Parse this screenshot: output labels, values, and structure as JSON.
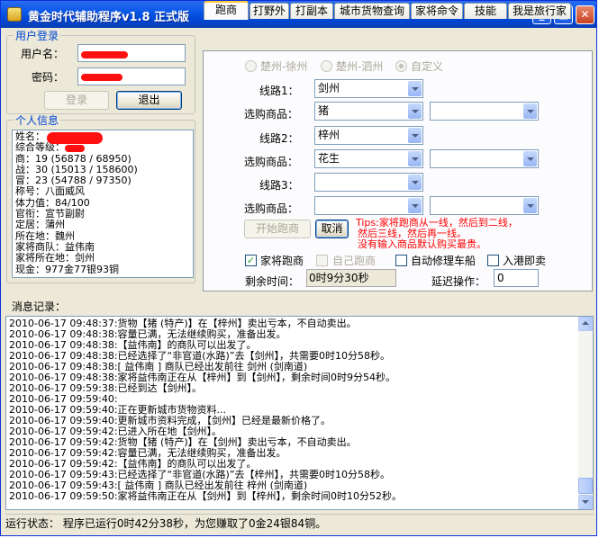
{
  "window": {
    "title": "黄金时代辅助程序v1.8 正式版",
    "min_icon": "minimize-icon",
    "max_icon": "maximize-icon",
    "close_icon": "close-icon"
  },
  "login": {
    "group_title": "用户登录",
    "user_label": "用户名：",
    "password_label": "密码：",
    "login_button": "登录",
    "logout_button": "退出"
  },
  "personal": {
    "group_title": "个人信息",
    "lines": [
      "姓名：",
      "综合等级：",
      "商：19 (56878 / 68950)",
      "战：30 (15013 / 158600)",
      "冒：23 (54788 / 97350)",
      "称号：八面威风",
      "体力值：84/100",
      "官衔：宣节副尉",
      "定居：蒲州",
      "所在地：魏州",
      "家将商队：益伟南",
      "家将所在地：剑州",
      "现金：977金77银93铜"
    ]
  },
  "tabs": [
    {
      "label": "跑商",
      "active": true
    },
    {
      "label": "打野外",
      "active": false
    },
    {
      "label": "打副本",
      "active": false
    },
    {
      "label": "城市货物查询",
      "active": false
    },
    {
      "label": "家将命令",
      "active": false
    },
    {
      "label": "技能",
      "active": false
    },
    {
      "label": "我是旅行家",
      "active": false
    }
  ],
  "run_trade": {
    "route_options": [
      "楚州-徐州",
      "楚州-泗州",
      "自定义"
    ],
    "route_selected": "自定义",
    "route1_label": "线路1：",
    "route2_label": "线路2：",
    "route3_label": "线路3：",
    "goods_label": "选购商品：",
    "route1_value": "剑州",
    "goods1_value": "猪",
    "route2_value": "梓州",
    "goods2_value": "花生",
    "start_button": "开始跑商",
    "cancel_button": "取消",
    "tips": [
      "Tips:家将跑商从一线，然后到二线，",
      "然后三线，然后再一线。",
      "没有输入商品默认购买最贵。"
    ],
    "check_family_trade": "家将跑商",
    "check_self_trade": "自己跑商",
    "check_auto_repair": "自动修理车船",
    "check_port_sell": "入港即卖",
    "remaining_label": "剩余时间：",
    "remaining_value": "0时9分30秒",
    "delay_label": "延迟操作：",
    "delay_value": "0"
  },
  "log": {
    "label": "消息记录：",
    "lines": [
      "2010-06-17 09:48:37:货物【猪 (特产)】在【梓州】卖出亏本，不自动卖出。",
      "2010-06-17 09:48:38:容量已满，无法继续购买，准备出发。",
      "2010-06-17 09:48:38:【益伟南】的商队可以出发了。",
      "2010-06-17 09:48:38:已经选择了“非官道(水路)”去【剑州】，共需要0时10分58秒。",
      "2010-06-17 09:48:38:[ 益伟南 ] 商队已经出发前往 剑州 (剑南道)",
      "2010-06-17 09:48:38:家将益伟南正在从【梓州】到【剑州】，剩余时间0时9分54秒。",
      "2010-06-17 09:59:38:已经到达【剑州】。",
      "2010-06-17 09:59:40:",
      "2010-06-17 09:59:40:正在更新城市货物资料...",
      "2010-06-17 09:59:40:更新城市资料完成，【剑州】已经是最新价格了。",
      "2010-06-17 09:59:42:已进入所在地【剑州】。",
      "2010-06-17 09:59:42:货物【猪 (特产)】在【剑州】卖出亏本，不自动卖出。",
      "2010-06-17 09:59:42:容量已满，无法继续购买，准备出发。",
      "2010-06-17 09:59:42:【益伟南】的商队可以出发了。",
      "2010-06-17 09:59:43:已经选择了“非官道(水路)”去【梓州】，共需要0时10分58秒。",
      "2010-06-17 09:59:43:[ 益伟南 ] 商队已经出发前往 梓州 (剑南道)",
      "2010-06-17 09:59:50:家将益伟南正在从【剑州】到【梓州】，剩余时间0时10分52秒。"
    ]
  },
  "status": {
    "label": "运行状态：",
    "text": "程序已运行0时42分38秒，为您赚取了0金24银84铜。"
  }
}
